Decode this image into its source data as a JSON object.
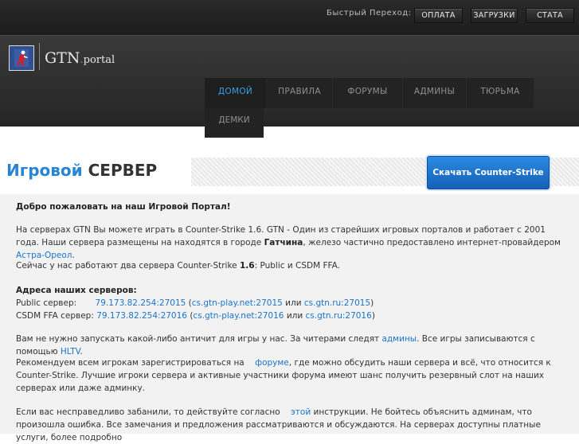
{
  "topbar": {
    "quick_label": "Быстрый Переход:",
    "buttons": [
      "ОПЛАТА",
      "ЗАГРУЗКИ",
      "СТАТА"
    ]
  },
  "logo": {
    "main": "GTN",
    "dot": ".",
    "sub": "portal"
  },
  "nav": {
    "items": [
      "ДОМОЙ",
      "ПРАВИЛА",
      "ФОРУМЫ",
      "АДМИНЫ",
      "ТЮРЬМА"
    ],
    "second_row": "ДЕМКИ"
  },
  "title": {
    "blue": "Игровой",
    "dark": "СЕРВЕР"
  },
  "download_button": "Скачать Counter-Strike",
  "content": {
    "welcome": "Добро пожаловать на наш Игровой Портал!",
    "p1_a": "На серверах GTN Вы можете играть в Counter-Strike 1.6. GTN - Один из старейших игровых порталов и работает с 2001 года. Наши сервера размещены на находятся в городе ",
    "p1_city": "Гатчина",
    "p1_b": ", железо частично предоставлено интернет-провайдером ",
    "p1_link": "Астра-Ореол",
    "p1_c": ".",
    "p2_a": "Сейчас у нас работают два сервера Counter-Strike ",
    "p2_version": "1.6",
    "p2_b": ": Public и CSDM FFA.",
    "addresses_heading": "Адреса наших серверов:",
    "public_label": "Public сервер:",
    "public_ip": "79.173.82.254:27015",
    "public_alt1": "cs.gtn-play.net:27015",
    "or": "или",
    "public_alt2": "cs.gtn.ru:27015",
    "csdm_label": "CSDM FFA сервер:",
    "csdm_ip": "79.173.82.254:27016",
    "csdm_alt1": "cs.gtn-play.net:27016",
    "csdm_alt2": "cs.gtn.ru:27016",
    "p4_a": "Вам не нужно запускать какой-либо античит для игры у нас. За читерами следят ",
    "p4_link1": "админы",
    "p4_b": ". Все игры записываются с помощью ",
    "p4_link2": "HLTV",
    "p4_c": ".",
    "p5_a": "Рекомендуем всем игрокам зарегистрироваться на ",
    "p5_link": "форуме",
    "p5_b": ", где можно обсудить наши сервера и всё, что относится к Counter-Strike. Лучшие игроки сервера и активные участники форума имеют шанс получить резервный слот на наших серверах или даже админку.",
    "p6_a": "Если вас несправедливо забанили, то действуйте согласно ",
    "p6_link": "этой",
    "p6_b": " инструкции. Не бойтесь объяснить админам, что произошла ошибка. Все замечания и предложения рассматриваются и обсуждаются. На серверах доступны платные услуги, более подробно"
  }
}
